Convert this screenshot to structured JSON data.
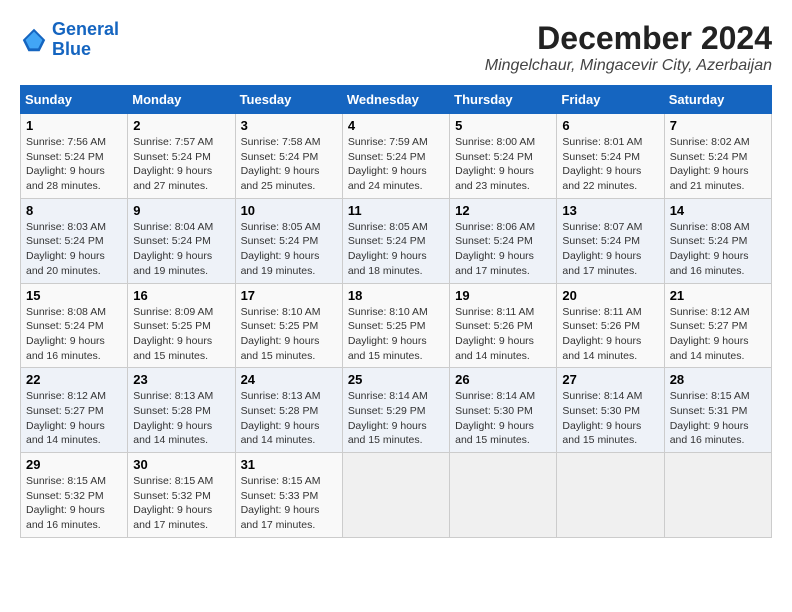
{
  "logo": {
    "line1": "General",
    "line2": "Blue"
  },
  "title": "December 2024",
  "subtitle": "Mingelchaur, Mingacevir City, Azerbaijan",
  "weekdays": [
    "Sunday",
    "Monday",
    "Tuesday",
    "Wednesday",
    "Thursday",
    "Friday",
    "Saturday"
  ],
  "weeks": [
    [
      {
        "day": "1",
        "rise": "Sunrise: 7:56 AM",
        "set": "Sunset: 5:24 PM",
        "daylight": "Daylight: 9 hours and 28 minutes."
      },
      {
        "day": "2",
        "rise": "Sunrise: 7:57 AM",
        "set": "Sunset: 5:24 PM",
        "daylight": "Daylight: 9 hours and 27 minutes."
      },
      {
        "day": "3",
        "rise": "Sunrise: 7:58 AM",
        "set": "Sunset: 5:24 PM",
        "daylight": "Daylight: 9 hours and 25 minutes."
      },
      {
        "day": "4",
        "rise": "Sunrise: 7:59 AM",
        "set": "Sunset: 5:24 PM",
        "daylight": "Daylight: 9 hours and 24 minutes."
      },
      {
        "day": "5",
        "rise": "Sunrise: 8:00 AM",
        "set": "Sunset: 5:24 PM",
        "daylight": "Daylight: 9 hours and 23 minutes."
      },
      {
        "day": "6",
        "rise": "Sunrise: 8:01 AM",
        "set": "Sunset: 5:24 PM",
        "daylight": "Daylight: 9 hours and 22 minutes."
      },
      {
        "day": "7",
        "rise": "Sunrise: 8:02 AM",
        "set": "Sunset: 5:24 PM",
        "daylight": "Daylight: 9 hours and 21 minutes."
      }
    ],
    [
      {
        "day": "8",
        "rise": "Sunrise: 8:03 AM",
        "set": "Sunset: 5:24 PM",
        "daylight": "Daylight: 9 hours and 20 minutes."
      },
      {
        "day": "9",
        "rise": "Sunrise: 8:04 AM",
        "set": "Sunset: 5:24 PM",
        "daylight": "Daylight: 9 hours and 19 minutes."
      },
      {
        "day": "10",
        "rise": "Sunrise: 8:05 AM",
        "set": "Sunset: 5:24 PM",
        "daylight": "Daylight: 9 hours and 19 minutes."
      },
      {
        "day": "11",
        "rise": "Sunrise: 8:05 AM",
        "set": "Sunset: 5:24 PM",
        "daylight": "Daylight: 9 hours and 18 minutes."
      },
      {
        "day": "12",
        "rise": "Sunrise: 8:06 AM",
        "set": "Sunset: 5:24 PM",
        "daylight": "Daylight: 9 hours and 17 minutes."
      },
      {
        "day": "13",
        "rise": "Sunrise: 8:07 AM",
        "set": "Sunset: 5:24 PM",
        "daylight": "Daylight: 9 hours and 17 minutes."
      },
      {
        "day": "14",
        "rise": "Sunrise: 8:08 AM",
        "set": "Sunset: 5:24 PM",
        "daylight": "Daylight: 9 hours and 16 minutes."
      }
    ],
    [
      {
        "day": "15",
        "rise": "Sunrise: 8:08 AM",
        "set": "Sunset: 5:24 PM",
        "daylight": "Daylight: 9 hours and 16 minutes."
      },
      {
        "day": "16",
        "rise": "Sunrise: 8:09 AM",
        "set": "Sunset: 5:25 PM",
        "daylight": "Daylight: 9 hours and 15 minutes."
      },
      {
        "day": "17",
        "rise": "Sunrise: 8:10 AM",
        "set": "Sunset: 5:25 PM",
        "daylight": "Daylight: 9 hours and 15 minutes."
      },
      {
        "day": "18",
        "rise": "Sunrise: 8:10 AM",
        "set": "Sunset: 5:25 PM",
        "daylight": "Daylight: 9 hours and 15 minutes."
      },
      {
        "day": "19",
        "rise": "Sunrise: 8:11 AM",
        "set": "Sunset: 5:26 PM",
        "daylight": "Daylight: 9 hours and 14 minutes."
      },
      {
        "day": "20",
        "rise": "Sunrise: 8:11 AM",
        "set": "Sunset: 5:26 PM",
        "daylight": "Daylight: 9 hours and 14 minutes."
      },
      {
        "day": "21",
        "rise": "Sunrise: 8:12 AM",
        "set": "Sunset: 5:27 PM",
        "daylight": "Daylight: 9 hours and 14 minutes."
      }
    ],
    [
      {
        "day": "22",
        "rise": "Sunrise: 8:12 AM",
        "set": "Sunset: 5:27 PM",
        "daylight": "Daylight: 9 hours and 14 minutes."
      },
      {
        "day": "23",
        "rise": "Sunrise: 8:13 AM",
        "set": "Sunset: 5:28 PM",
        "daylight": "Daylight: 9 hours and 14 minutes."
      },
      {
        "day": "24",
        "rise": "Sunrise: 8:13 AM",
        "set": "Sunset: 5:28 PM",
        "daylight": "Daylight: 9 hours and 14 minutes."
      },
      {
        "day": "25",
        "rise": "Sunrise: 8:14 AM",
        "set": "Sunset: 5:29 PM",
        "daylight": "Daylight: 9 hours and 15 minutes."
      },
      {
        "day": "26",
        "rise": "Sunrise: 8:14 AM",
        "set": "Sunset: 5:30 PM",
        "daylight": "Daylight: 9 hours and 15 minutes."
      },
      {
        "day": "27",
        "rise": "Sunrise: 8:14 AM",
        "set": "Sunset: 5:30 PM",
        "daylight": "Daylight: 9 hours and 15 minutes."
      },
      {
        "day": "28",
        "rise": "Sunrise: 8:15 AM",
        "set": "Sunset: 5:31 PM",
        "daylight": "Daylight: 9 hours and 16 minutes."
      }
    ],
    [
      {
        "day": "29",
        "rise": "Sunrise: 8:15 AM",
        "set": "Sunset: 5:32 PM",
        "daylight": "Daylight: 9 hours and 16 minutes."
      },
      {
        "day": "30",
        "rise": "Sunrise: 8:15 AM",
        "set": "Sunset: 5:32 PM",
        "daylight": "Daylight: 9 hours and 17 minutes."
      },
      {
        "day": "31",
        "rise": "Sunrise: 8:15 AM",
        "set": "Sunset: 5:33 PM",
        "daylight": "Daylight: 9 hours and 17 minutes."
      },
      null,
      null,
      null,
      null
    ]
  ]
}
